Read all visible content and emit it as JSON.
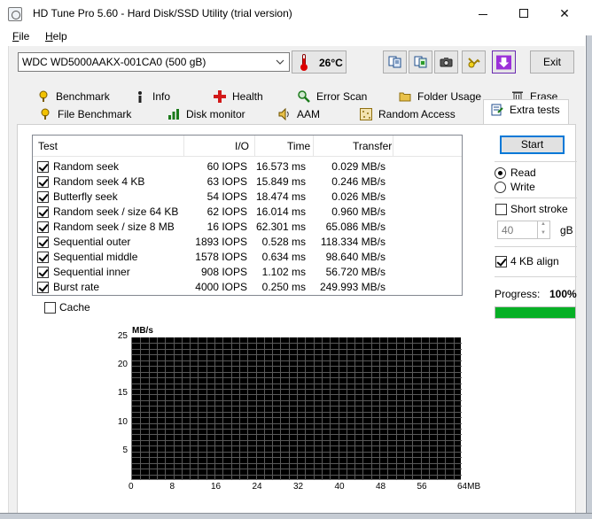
{
  "window": {
    "title": "HD Tune Pro 5.60 - Hard Disk/SSD Utility (trial version)",
    "min_glyph": "—",
    "close_glyph": "✕"
  },
  "menu": {
    "file": "File",
    "help": "Help"
  },
  "toolbar": {
    "drive": "WDC WD5000AAKX-001CA0 (500 gB)",
    "temperature": "26°C",
    "exit_label": "Exit",
    "icons": [
      "copy-info-icon",
      "copy-screenshot-icon",
      "camera-icon",
      "health-refresh-icon",
      "download-icon"
    ]
  },
  "tabs": {
    "row1": [
      {
        "label": "Benchmark",
        "icon": "benchmark-icon"
      },
      {
        "label": "Info",
        "icon": "info-icon"
      },
      {
        "label": "Health",
        "icon": "health-icon"
      },
      {
        "label": "Error Scan",
        "icon": "error-scan-icon"
      },
      {
        "label": "Folder Usage",
        "icon": "folder-icon"
      },
      {
        "label": "Erase",
        "icon": "trash-icon"
      }
    ],
    "row2": [
      {
        "label": "File Benchmark",
        "icon": "file-benchmark-icon"
      },
      {
        "label": "Disk monitor",
        "icon": "disk-monitor-icon"
      },
      {
        "label": "AAM",
        "icon": "speaker-icon"
      },
      {
        "label": "Random Access",
        "icon": "random-access-icon"
      },
      {
        "label": "Extra tests",
        "icon": "extra-tests-icon",
        "active": true
      }
    ]
  },
  "results": {
    "headers": {
      "test": "Test",
      "io": "I/O",
      "time": "Time",
      "transfer": "Transfer"
    },
    "rows": [
      {
        "test": "Random seek",
        "io": "60 IOPS",
        "time": "16.573 ms",
        "transfer": "0.029 MB/s",
        "checked": true
      },
      {
        "test": "Random seek 4 KB",
        "io": "63 IOPS",
        "time": "15.849 ms",
        "transfer": "0.246 MB/s",
        "checked": true
      },
      {
        "test": "Butterfly seek",
        "io": "54 IOPS",
        "time": "18.474 ms",
        "transfer": "0.026 MB/s",
        "checked": true
      },
      {
        "test": "Random seek / size 64 KB",
        "io": "62 IOPS",
        "time": "16.014 ms",
        "transfer": "0.960 MB/s",
        "checked": true
      },
      {
        "test": "Random seek / size 8 MB",
        "io": "16 IOPS",
        "time": "62.301 ms",
        "transfer": "65.086 MB/s",
        "checked": true
      },
      {
        "test": "Sequential outer",
        "io": "1893 IOPS",
        "time": "0.528 ms",
        "transfer": "118.334 MB/s",
        "checked": true
      },
      {
        "test": "Sequential middle",
        "io": "1578 IOPS",
        "time": "0.634 ms",
        "transfer": "98.640 MB/s",
        "checked": true
      },
      {
        "test": "Sequential inner",
        "io": "908 IOPS",
        "time": "1.102 ms",
        "transfer": "56.720 MB/s",
        "checked": true
      },
      {
        "test": "Burst rate",
        "io": "4000 IOPS",
        "time": "0.250 ms",
        "transfer": "249.993 MB/s",
        "checked": true
      }
    ]
  },
  "options": {
    "cache_label": "Cache",
    "cache_checked": false,
    "start_label": "Start",
    "read_label": "Read",
    "write_label": "Write",
    "mode": "read",
    "short_stroke_label": "Short stroke",
    "short_stroke_checked": false,
    "short_stroke_value": "40",
    "short_stroke_unit": "gB",
    "align_label": "4 KB align",
    "align_checked": true,
    "progress_label": "Progress:",
    "progress_text": "100%",
    "progress_fraction": 1.0,
    "progress_color": "#06b025"
  },
  "graph": {
    "unit": "MB/s",
    "y_ticks": [
      "25",
      "20",
      "15",
      "10",
      "5"
    ],
    "x_ticks": [
      "0",
      "8",
      "16",
      "24",
      "32",
      "40",
      "48",
      "56",
      "64MB"
    ],
    "background": "#000000",
    "grid_color": "#5a5a5a"
  }
}
